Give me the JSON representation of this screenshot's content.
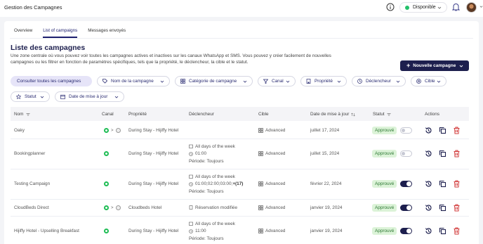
{
  "app": {
    "title": "Gestion des Campagnes"
  },
  "header": {
    "status": "Disponible"
  },
  "tabs": [
    {
      "label": "Overview",
      "active": false
    },
    {
      "label": "List of campaigns",
      "active": true
    },
    {
      "label": "Messages envoyés",
      "active": false
    }
  ],
  "page": {
    "title": "Liste des campagnes",
    "description": "Une zone centrale où vous pouvez voir toutes les campagnes actives et inactives sur les canaux WhatsApp et SMS. Vous pouvez y créer facilement de nouvelles campagnes ou les filtrer en fonction de paramètres spécifiques, tels que la propriété, le déclencheur, la cible et le statut.",
    "new_button": "Nouvelle campagne"
  },
  "filters": {
    "all": "Consulter toutes les campagnes",
    "nom": "Nom de la campagne",
    "categorie": "Catégorie de campagne",
    "canal": "Canal",
    "propriete": "Propriété",
    "declencheur": "Déclencheur",
    "cible": "Cible",
    "statut": "Statut",
    "date": "Date de mise à jour"
  },
  "table": {
    "headers": {
      "nom": "Nom",
      "canal": "Canal",
      "propriete": "Propriété",
      "declencheur": "Déclencheur",
      "cible": "Cible",
      "date": "Date de mise à jour",
      "statut": "Statut",
      "actions": "Actions"
    },
    "rows": [
      {
        "nom": "Oaky",
        "canal_gt": ">",
        "propriete": "During Stay - Hijiffy Hotel",
        "cible": "Advanced",
        "date": "juillet 17, 2024",
        "statut": "Approuvé",
        "active": false
      },
      {
        "nom": "Bookingplanner",
        "propriete": "During Stay - Hijiffy Hotel",
        "trig_1": "All days of the week",
        "trig_2": "01:00",
        "trig_3": "Période: Toujours",
        "cible": "Advanced",
        "date": "juillet 15, 2024",
        "statut": "Approuvé",
        "active": false
      },
      {
        "nom": "Testing Campaign",
        "propriete": "During Stay - Hijiffy Hotel",
        "trig_1": "All days of the week",
        "trig_2": "01:00;02:00;03:00;",
        "trig_2b": "+(17)",
        "trig_3": "Période: Toujours",
        "cible": "Advanced",
        "date": "février 22, 2024",
        "statut": "Approuvé",
        "active": true
      },
      {
        "nom": "CloudBeds Direct",
        "canal_gt": ">",
        "propriete": "Cloudbeds Hotel",
        "trig_1": "Réservation modifiée",
        "cible": "Advanced",
        "date": "janvier 19, 2024",
        "statut": "Approuvé",
        "active": true
      },
      {
        "nom": "Hijiffy Hotel - Upselling Breakfast",
        "propriete": "During Stay - Hijiffy Hotel",
        "trig_1": "All days of the week",
        "trig_2": "11:00",
        "trig_3": "Période: Toujours",
        "cible": "Advanced",
        "date": "janvier 19, 2024",
        "statut": "Approuvé",
        "active": true
      }
    ]
  },
  "colors": {
    "brand": "#1d1f4e",
    "accent": "#2a2c72",
    "success_bg": "#dcf3d8",
    "success": "#2f7a35",
    "danger": "#d23a3a",
    "whatsapp": "#1fbd55"
  },
  "icons": [
    "info-icon",
    "chevron-down-icon",
    "bell-icon",
    "plus-icon",
    "tag-icon",
    "grid-icon",
    "filter-icon",
    "building-icon",
    "clock-icon",
    "target-icon",
    "star-icon",
    "calendar-icon",
    "sort-icon",
    "whatsapp-icon",
    "history-icon",
    "copy-icon",
    "trash-icon"
  ]
}
